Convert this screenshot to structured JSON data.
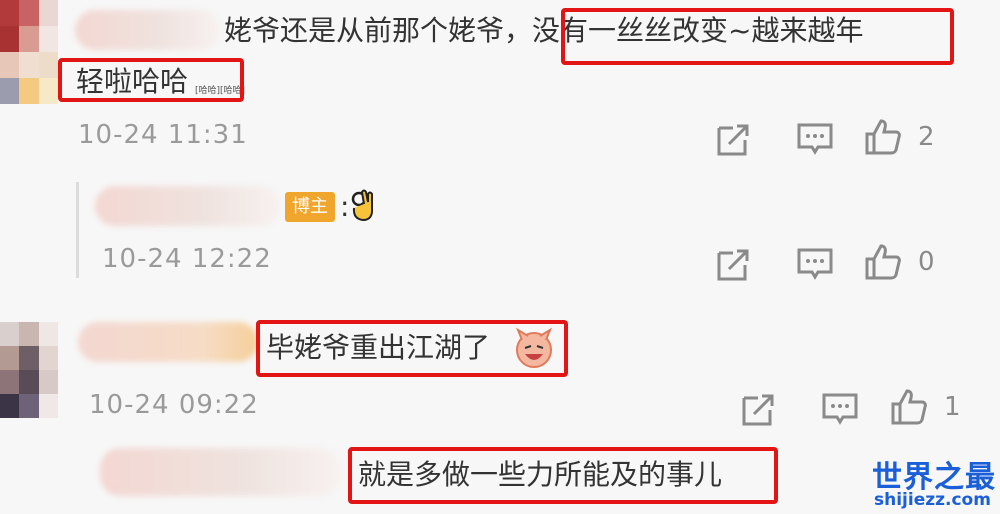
{
  "comments": [
    {
      "text_line1": "姥爷还是从前那个姥爷，没有一丝丝改变~越来越年",
      "text_line2": "轻啦哈哈",
      "tiny_emoji_text": "[哈哈][哈哈]",
      "time": "10-24 11:31",
      "like_count": "2",
      "reply": {
        "badge": "博主",
        "text": ":",
        "time": "10-24 12:22",
        "like_count": "0"
      }
    },
    {
      "text": "毕姥爷重出江湖了",
      "time": "10-24 09:22",
      "like_count": "1",
      "reply": {
        "text": "就是多做一些力所能及的事儿"
      }
    }
  ],
  "icons": {
    "share": "share-icon",
    "comment": "comment-icon",
    "like": "like-icon"
  },
  "watermark": {
    "title": "世界之最",
    "url": "shijiezz.com"
  },
  "colors": {
    "highlight": "#e21414",
    "badge": "#f0a52c",
    "watermark_blue": "#1a5fd8"
  }
}
